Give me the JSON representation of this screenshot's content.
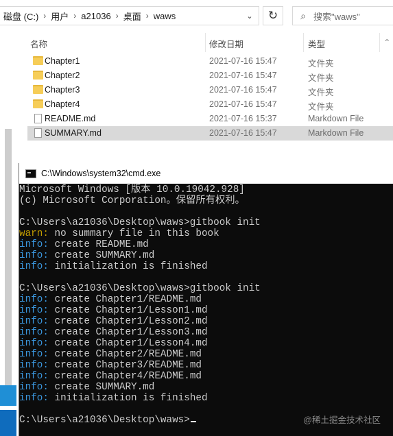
{
  "address": {
    "crumbs": [
      "磁盘 (C:)",
      "用户",
      "a21036",
      "桌面",
      "waws"
    ],
    "refresh_icon": "refresh-icon",
    "search_placeholder": "搜索\"waws\""
  },
  "columns": {
    "name": "名称",
    "date": "修改日期",
    "type": "类型"
  },
  "files": [
    {
      "name": "Chapter1",
      "date": "2021-07-16 15:47",
      "type": "文件夹",
      "kind": "folder"
    },
    {
      "name": "Chapter2",
      "date": "2021-07-16 15:47",
      "type": "文件夹",
      "kind": "folder"
    },
    {
      "name": "Chapter3",
      "date": "2021-07-16 15:47",
      "type": "文件夹",
      "kind": "folder"
    },
    {
      "name": "Chapter4",
      "date": "2021-07-16 15:47",
      "type": "文件夹",
      "kind": "folder"
    },
    {
      "name": "README.md",
      "date": "2021-07-16 15:37",
      "type": "Markdown File",
      "kind": "md"
    },
    {
      "name": "SUMMARY.md",
      "date": "2021-07-16 15:47",
      "type": "Markdown File",
      "kind": "md",
      "selected": true
    }
  ],
  "cmd": {
    "title": "C:\\Windows\\system32\\cmd.exe",
    "lines": [
      {
        "text": "Microsoft Windows [版本 10.0.19042.928]"
      },
      {
        "text": "(c) Microsoft Corporation。保留所有权利。"
      },
      {
        "text": ""
      },
      {
        "text": "C:\\Users\\a21036\\Desktop\\waws>gitbook init"
      },
      {
        "prefix": "warn:",
        "kind": "warn",
        "text": " no summary file in this book"
      },
      {
        "prefix": "info:",
        "kind": "info",
        "text": " create README.md"
      },
      {
        "prefix": "info:",
        "kind": "info",
        "text": " create SUMMARY.md"
      },
      {
        "prefix": "info:",
        "kind": "info",
        "text": " initialization is finished"
      },
      {
        "text": ""
      },
      {
        "text": "C:\\Users\\a21036\\Desktop\\waws>gitbook init"
      },
      {
        "prefix": "info:",
        "kind": "info",
        "text": " create Chapter1/README.md"
      },
      {
        "prefix": "info:",
        "kind": "info",
        "text": " create Chapter1/Lesson1.md"
      },
      {
        "prefix": "info:",
        "kind": "info",
        "text": " create Chapter1/Lesson2.md"
      },
      {
        "prefix": "info:",
        "kind": "info",
        "text": " create Chapter1/Lesson3.md"
      },
      {
        "prefix": "info:",
        "kind": "info",
        "text": " create Chapter1/Lesson4.md"
      },
      {
        "prefix": "info:",
        "kind": "info",
        "text": " create Chapter2/README.md"
      },
      {
        "prefix": "info:",
        "kind": "info",
        "text": " create Chapter3/README.md"
      },
      {
        "prefix": "info:",
        "kind": "info",
        "text": " create Chapter4/README.md"
      },
      {
        "prefix": "info:",
        "kind": "info",
        "text": " create SUMMARY.md"
      },
      {
        "prefix": "info:",
        "kind": "info",
        "text": " initialization is finished"
      },
      {
        "text": ""
      },
      {
        "text": "C:\\Users\\a21036\\Desktop\\waws>",
        "cursor": true
      }
    ]
  },
  "watermark": "@稀土掘金技术社区"
}
